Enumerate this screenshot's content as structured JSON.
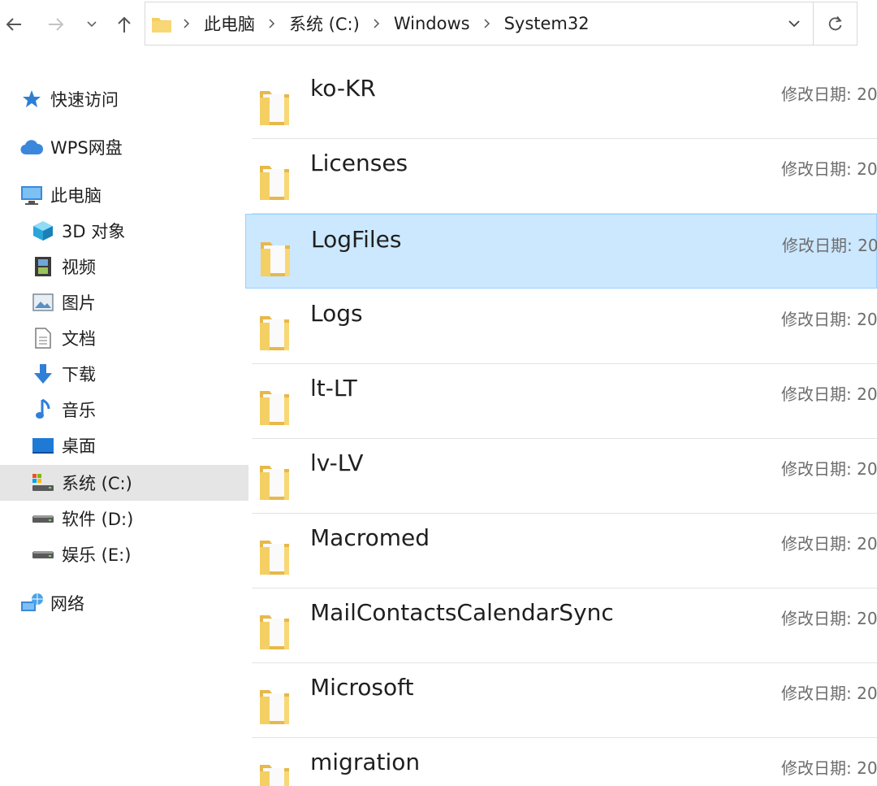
{
  "nav": {
    "back": "back-arrow-icon",
    "forward": "forward-arrow-icon",
    "recent": "chevron-down-icon",
    "up": "up-arrow-icon"
  },
  "address": {
    "crumbs": [
      "此电脑",
      "系统 (C:)",
      "Windows",
      "System32"
    ],
    "dropdown": "chevron-down-icon",
    "refresh": "refresh-icon"
  },
  "sidebar": {
    "items": [
      {
        "label": "快速访问",
        "icon": "star-icon"
      },
      {
        "label": "WPS网盘",
        "icon": "cloud-icon"
      },
      {
        "label": "此电脑",
        "icon": "computer-icon"
      },
      {
        "label": "3D 对象",
        "icon": "cube-icon"
      },
      {
        "label": "视频",
        "icon": "film-icon"
      },
      {
        "label": "图片",
        "icon": "picture-icon"
      },
      {
        "label": "文档",
        "icon": "document-icon"
      },
      {
        "label": "下载",
        "icon": "download-icon"
      },
      {
        "label": "音乐",
        "icon": "music-icon"
      },
      {
        "label": "桌面",
        "icon": "desktop-icon"
      },
      {
        "label": "系统 (C:)",
        "icon": "system-drive-icon",
        "selected": true
      },
      {
        "label": "软件 (D:)",
        "icon": "drive-icon"
      },
      {
        "label": "娱乐 (E:)",
        "icon": "drive-icon"
      },
      {
        "label": "网络",
        "icon": "network-icon"
      }
    ]
  },
  "files": {
    "date_label": "修改日期: 20",
    "items": [
      {
        "name": "ko-KR",
        "icon": "folder-icon"
      },
      {
        "name": "Licenses",
        "icon": "folder-icon"
      },
      {
        "name": "LogFiles",
        "icon": "folder-icon",
        "selected": true
      },
      {
        "name": "Logs",
        "icon": "folder-icon"
      },
      {
        "name": "lt-LT",
        "icon": "folder-icon"
      },
      {
        "name": "lv-LV",
        "icon": "folder-icon"
      },
      {
        "name": "Macromed",
        "icon": "folder-icon"
      },
      {
        "name": "MailContactsCalendarSync",
        "icon": "folder-icon"
      },
      {
        "name": "Microsoft",
        "icon": "folder-icon"
      },
      {
        "name": "migration",
        "icon": "folder-icon"
      }
    ]
  },
  "colors": {
    "selected_row": "#cce8ff",
    "selected_border": "#99d1ff",
    "sidebar_selected": "#e5e5e5",
    "folder": "#f4cf63"
  }
}
